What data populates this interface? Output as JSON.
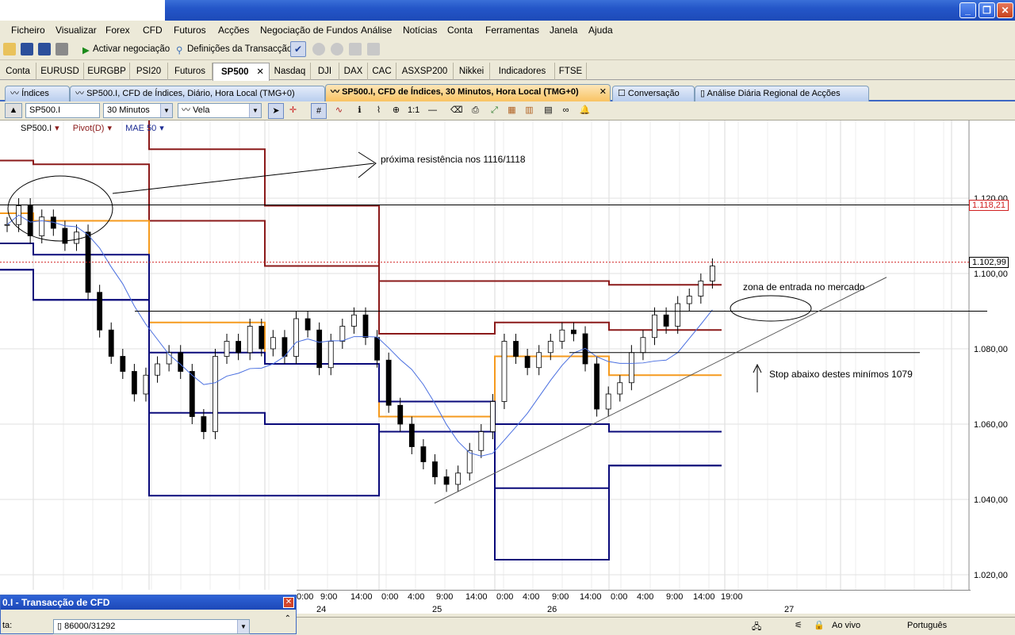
{
  "menu": [
    "Ficheiro",
    "Visualizar",
    "Forex",
    "CFD",
    "Futuros",
    "Acções",
    "Negociação de Fundos",
    "Análise",
    "Notícias",
    "Conta",
    "Ferramentas",
    "Janela",
    "Ajuda"
  ],
  "toolbar": {
    "activate_label": "Activar negociação",
    "settings_label": "Definições da Transacção"
  },
  "instrument_tabs": [
    "Conta",
    "EURUSD",
    "EURGBP",
    "PSI20",
    "Futuros",
    "SP500",
    "Nasdaq",
    "DJI",
    "DAX",
    "CAC",
    "ASXSP200",
    "Nikkei",
    "Indicadores",
    "FTSE"
  ],
  "active_instrument": "SP500",
  "window_tabs": [
    "Índices",
    "SP500.I, CFD de Índices, Diário, Hora Local (TMG+0)",
    "SP500.I, CFD de Índices, 30 Minutos, Hora Local (TMG+0)",
    "Conversação",
    "Análise Diária Regional de Acções"
  ],
  "chart_toolbar": {
    "symbol": "SP500.I",
    "period": "30 Minutos",
    "style": "Vela",
    "scale_label": "1:1"
  },
  "legend": [
    "SP500.I",
    "Pivot(D)",
    "MAE 50"
  ],
  "y_ticks": [
    "1.120,00",
    "1.100,00",
    "1.080,00",
    "1.060,00",
    "1.040,00",
    "1.020,00"
  ],
  "price_boxes": {
    "resistance": "1.118,21",
    "current": "1.102,99"
  },
  "x_times": [
    "0:00",
    "9:00",
    "14:00",
    "0:00",
    "4:00",
    "9:00",
    "14:00",
    "0:00",
    "4:00",
    "9:00",
    "14:00",
    "0:00",
    "4:00",
    "9:00",
    "14:00",
    "19:00"
  ],
  "x_dates": [
    "24",
    "25",
    "26",
    "27"
  ],
  "annotations": {
    "resistance": "próxima resistência nos 1116/1118",
    "entry": "zona de entrada no mercado",
    "stop": "Stop abaixo destes minímos 1079"
  },
  "panel": {
    "title": "0.I - Transacção de CFD",
    "account_label": "ta:",
    "account_value": "86000/31292"
  },
  "status": {
    "live": "Ao vivo",
    "language": "Português"
  },
  "colors": {
    "pivot": "#8b1a1a",
    "support": "#0a0a7a",
    "mid": "#f59a1e",
    "ma": "#4a6fe0",
    "titlebar": "#2456c8"
  }
}
